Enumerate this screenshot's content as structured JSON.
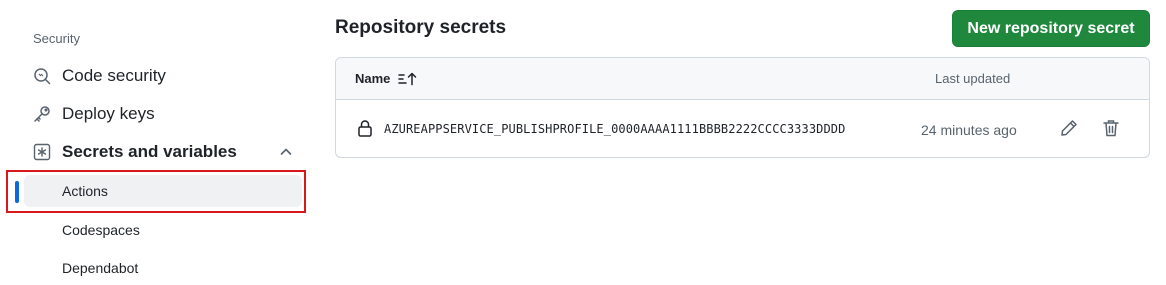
{
  "sidebar": {
    "section_heading": "Security",
    "items": [
      {
        "label": "Code security",
        "icon": "shield-search-icon"
      },
      {
        "label": "Deploy keys",
        "icon": "key-icon"
      },
      {
        "label": "Secrets and variables",
        "icon": "asterisk-box-icon",
        "expanded": true
      }
    ],
    "sub_items": [
      {
        "label": "Actions",
        "active": true
      },
      {
        "label": "Codespaces"
      },
      {
        "label": "Dependabot"
      }
    ]
  },
  "main": {
    "title": "Repository secrets",
    "new_button_label": "New repository secret",
    "table": {
      "columns": {
        "name": "Name",
        "updated": "Last updated"
      },
      "rows": [
        {
          "name": "AZUREAPPSERVICE_PUBLISHPROFILE_0000AAAA1111BBBB2222CCCC3333DDDD",
          "updated": "24 minutes ago"
        }
      ]
    }
  },
  "colors": {
    "accent_blue": "#0969da",
    "primary_green": "#1f883d",
    "highlight_red": "#d7191c"
  }
}
